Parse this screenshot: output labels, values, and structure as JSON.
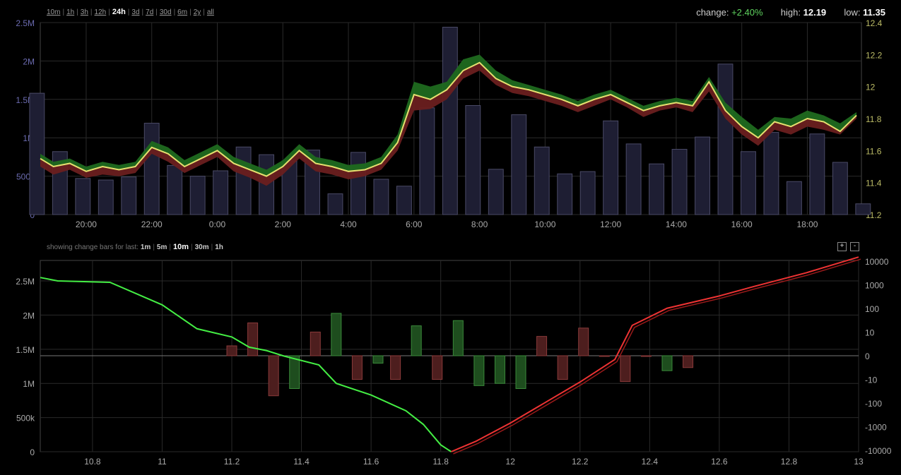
{
  "range_selector": {
    "options": [
      "10m",
      "1h",
      "3h",
      "12h",
      "24h",
      "3d",
      "7d",
      "30d",
      "6m",
      "2y",
      "all"
    ],
    "active": "24h"
  },
  "stats": {
    "change_label": "change:",
    "change_value": "+2.40%",
    "high_label": "high:",
    "high_value": "12.19",
    "low_label": "low:",
    "low_value": "11.35"
  },
  "change_bars": {
    "label": "showing change bars for last:",
    "options": [
      "1m",
      "5m",
      "10m",
      "30m",
      "1h"
    ],
    "active": "10m",
    "zoom_in": "+",
    "zoom_out": "-"
  },
  "colors": {
    "grid": "#2a2a2a",
    "volume_bar": "#1e1e33",
    "volume_stroke": "#4a4a66",
    "price_line": "#e6e070",
    "up_fill": "#1f6a1f",
    "down_fill": "#6a1f1f",
    "bid_line": "#44ee44",
    "ask_line": "#ee3333",
    "axis_left": "#6b6bb0",
    "axis_right": "#bbbb66"
  },
  "chart_data": [
    {
      "type": "line",
      "description_series": "price with volume bars",
      "x_ticks": [
        "20:00",
        "22:00",
        "0:00",
        "2:00",
        "4:00",
        "6:00",
        "8:00",
        "10:00",
        "12:00",
        "14:00",
        "16:00",
        "18:00"
      ],
      "y_left_ticks": [
        "0",
        "500k",
        "1M",
        "1.5M",
        "2M",
        "2.5M"
      ],
      "y_left_lim": [
        0,
        2500000
      ],
      "y_right_ticks": [
        "11.2",
        "11.4",
        "11.6",
        "11.8",
        "12",
        "12.2",
        "12.4"
      ],
      "y_right_lim": [
        11.2,
        12.4
      ],
      "x_hours": [
        18.6,
        19.0,
        19.5,
        20.0,
        20.5,
        21.0,
        21.5,
        22.0,
        22.5,
        23.0,
        23.5,
        24.0,
        24.5,
        25.0,
        25.5,
        26.0,
        26.5,
        27.0,
        27.5,
        28.0,
        28.5,
        29.0,
        29.5,
        30.0,
        30.5,
        31.0,
        31.5,
        32.0,
        32.5,
        33.0,
        33.5,
        34.0,
        34.5,
        35.0,
        35.5,
        36.0,
        36.5,
        37.0,
        37.5,
        38.0,
        38.5,
        39.0,
        39.5,
        40.0,
        40.5,
        41.0,
        41.5,
        42.0,
        42.5,
        43.0,
        43.5
      ],
      "price": [
        11.55,
        11.5,
        11.52,
        11.47,
        11.5,
        11.48,
        11.5,
        11.62,
        11.58,
        11.5,
        11.55,
        11.6,
        11.52,
        11.48,
        11.44,
        11.5,
        11.6,
        11.52,
        11.5,
        11.47,
        11.48,
        11.52,
        11.65,
        11.95,
        11.92,
        11.98,
        12.1,
        12.15,
        12.05,
        12.0,
        11.98,
        11.95,
        11.92,
        11.88,
        11.92,
        11.95,
        11.9,
        11.85,
        11.88,
        11.9,
        11.88,
        12.03,
        11.85,
        11.75,
        11.68,
        11.78,
        11.75,
        11.8,
        11.78,
        11.72,
        11.82
      ],
      "upper": [
        11.58,
        11.53,
        11.55,
        11.5,
        11.53,
        11.51,
        11.53,
        11.66,
        11.62,
        11.54,
        11.59,
        11.64,
        11.56,
        11.52,
        11.48,
        11.54,
        11.64,
        11.56,
        11.54,
        11.51,
        11.52,
        11.56,
        11.7,
        12.03,
        12.0,
        12.03,
        12.17,
        12.2,
        12.1,
        12.04,
        12.01,
        11.98,
        11.95,
        11.91,
        11.95,
        11.98,
        11.93,
        11.88,
        11.91,
        11.93,
        11.91,
        12.06,
        11.9,
        11.81,
        11.73,
        11.81,
        11.8,
        11.85,
        11.82,
        11.77,
        11.84
      ],
      "lower": [
        11.5,
        11.45,
        11.48,
        11.43,
        11.45,
        11.44,
        11.46,
        11.58,
        11.53,
        11.46,
        11.51,
        11.56,
        11.47,
        11.43,
        11.38,
        11.45,
        11.55,
        11.47,
        11.45,
        11.42,
        11.44,
        11.48,
        11.6,
        11.85,
        11.86,
        11.92,
        12.05,
        12.1,
        12.01,
        11.96,
        11.94,
        11.91,
        11.88,
        11.84,
        11.88,
        11.92,
        11.87,
        11.81,
        11.85,
        11.87,
        11.84,
        11.97,
        11.8,
        11.7,
        11.63,
        11.73,
        11.7,
        11.75,
        11.73,
        11.7,
        11.8
      ],
      "volume_hours": [
        18.5,
        19.2,
        19.9,
        20.6,
        21.3,
        22.0,
        22.7,
        23.4,
        24.1,
        24.8,
        25.5,
        26.2,
        26.9,
        27.6,
        28.3,
        29.0,
        29.7,
        30.4,
        31.1,
        31.8,
        32.5,
        33.2,
        33.9,
        34.6,
        35.3,
        36.0,
        36.7,
        37.4,
        38.1,
        38.8,
        39.5,
        40.2,
        40.9,
        41.6,
        42.3,
        43.0,
        43.7
      ],
      "volume": [
        1580000,
        820000,
        470000,
        450000,
        490000,
        1190000,
        640000,
        500000,
        570000,
        880000,
        780000,
        700000,
        840000,
        270000,
        810000,
        460000,
        370000,
        1390000,
        2440000,
        1420000,
        590000,
        1300000,
        880000,
        530000,
        560000,
        1220000,
        920000,
        660000,
        850000,
        1010000,
        1960000,
        820000,
        1070000,
        430000,
        1050000,
        680000,
        140000
      ]
    },
    {
      "type": "line",
      "description_series": "market depth",
      "x_ticks": [
        "10.8",
        "11",
        "11.2",
        "11.4",
        "11.6",
        "11.8",
        "12",
        "12.2",
        "12.4",
        "12.6",
        "12.8",
        "13"
      ],
      "x_lim": [
        10.65,
        13.0
      ],
      "y_left_ticks": [
        "0",
        "500k",
        "1M",
        "1.5M",
        "2M",
        "2.5M"
      ],
      "y_left_lim": [
        0,
        2800000
      ],
      "y_right_ticks": [
        "10000",
        "1000",
        "100",
        "10",
        "0",
        "-10",
        "-100",
        "-1000",
        "-10000"
      ],
      "bid": [
        [
          10.65,
          2550000
        ],
        [
          10.7,
          2500000
        ],
        [
          10.85,
          2480000
        ],
        [
          11.0,
          2150000
        ],
        [
          11.1,
          1800000
        ],
        [
          11.2,
          1680000
        ],
        [
          11.25,
          1530000
        ],
        [
          11.3,
          1480000
        ],
        [
          11.35,
          1400000
        ],
        [
          11.45,
          1270000
        ],
        [
          11.5,
          1000000
        ],
        [
          11.6,
          830000
        ],
        [
          11.7,
          600000
        ],
        [
          11.75,
          400000
        ],
        [
          11.8,
          100000
        ],
        [
          11.83,
          0
        ]
      ],
      "ask": [
        [
          11.83,
          0
        ],
        [
          11.9,
          150000
        ],
        [
          12.0,
          420000
        ],
        [
          12.1,
          720000
        ],
        [
          12.2,
          1020000
        ],
        [
          12.3,
          1350000
        ],
        [
          12.35,
          1850000
        ],
        [
          12.45,
          2100000
        ],
        [
          12.6,
          2280000
        ],
        [
          12.7,
          2420000
        ],
        [
          12.85,
          2620000
        ],
        [
          13.0,
          2850000
        ]
      ],
      "change_bars": [
        {
          "price": 11.2,
          "value": 1.5,
          "color": "red"
        },
        {
          "price": 11.26,
          "value": 20,
          "color": "red"
        },
        {
          "price": 11.32,
          "value": -40,
          "color": "red"
        },
        {
          "price": 11.38,
          "value": -20,
          "color": "green"
        },
        {
          "price": 11.44,
          "value": 8,
          "color": "red"
        },
        {
          "price": 11.5,
          "value": 50,
          "color": "green"
        },
        {
          "price": 11.56,
          "value": -8,
          "color": "red"
        },
        {
          "price": 11.62,
          "value": -1,
          "color": "green"
        },
        {
          "price": 11.67,
          "value": -8,
          "color": "red"
        },
        {
          "price": 11.73,
          "value": 15,
          "color": "green"
        },
        {
          "price": 11.79,
          "value": -8,
          "color": "red"
        },
        {
          "price": 11.85,
          "value": 25,
          "color": "green"
        },
        {
          "price": 11.91,
          "value": -15,
          "color": "green"
        },
        {
          "price": 11.97,
          "value": -12,
          "color": "green"
        },
        {
          "price": 12.03,
          "value": -20,
          "color": "green"
        },
        {
          "price": 12.09,
          "value": 5,
          "color": "red"
        },
        {
          "price": 12.15,
          "value": -8,
          "color": "red"
        },
        {
          "price": 12.21,
          "value": 12,
          "color": "red"
        },
        {
          "price": 12.27,
          "value": 0,
          "color": "red"
        },
        {
          "price": 12.33,
          "value": -10,
          "color": "red"
        },
        {
          "price": 12.39,
          "value": 0,
          "color": "red"
        },
        {
          "price": 12.45,
          "value": -3,
          "color": "green"
        },
        {
          "price": 12.51,
          "value": -2,
          "color": "red"
        }
      ]
    }
  ]
}
